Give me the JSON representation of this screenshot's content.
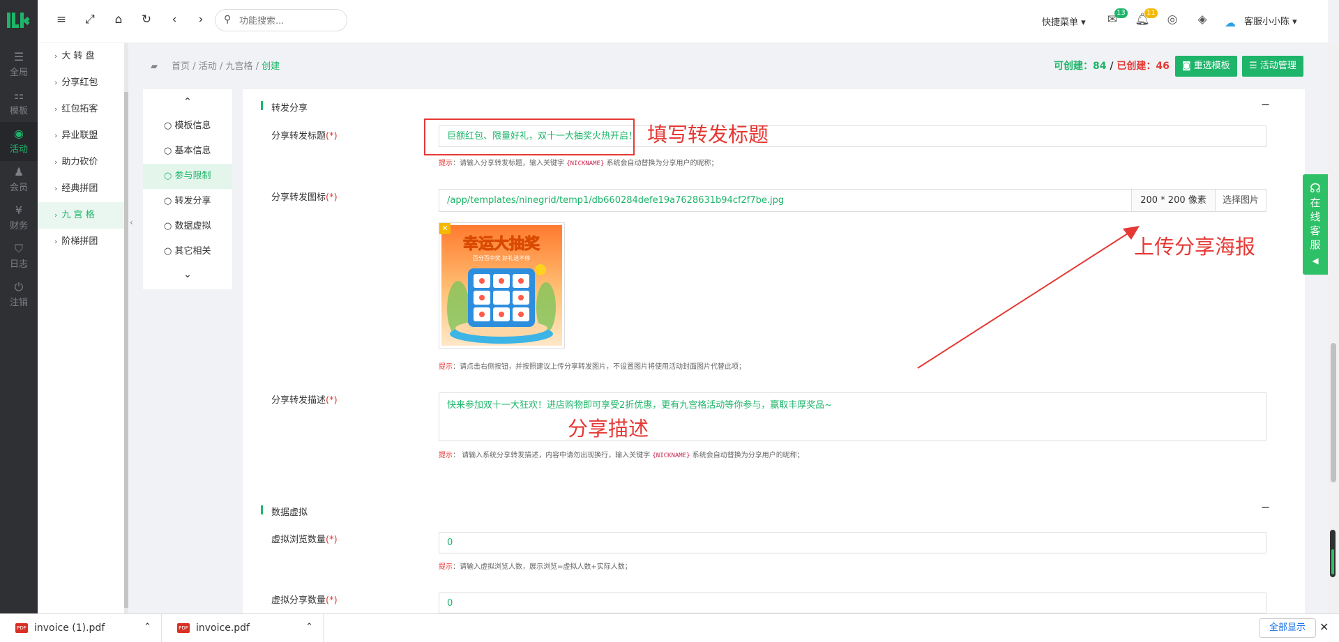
{
  "brand": {
    "color": "#1eb56a",
    "alert_red": "#e53935",
    "dark_sidebar": "#2f3033"
  },
  "iconbar": {
    "items": [
      {
        "label": "全局",
        "icon": "sliders-icon"
      },
      {
        "label": "模板",
        "icon": "sitemap-icon"
      },
      {
        "label": "活动",
        "icon": "target-icon",
        "active": true
      },
      {
        "label": "会员",
        "icon": "users-icon"
      },
      {
        "label": "财务",
        "icon": "money-icon"
      },
      {
        "label": "日志",
        "icon": "shield-icon"
      },
      {
        "label": "注销",
        "icon": "power-icon"
      }
    ]
  },
  "subnav": {
    "items": [
      {
        "label": "大 转 盘"
      },
      {
        "label": "分享红包"
      },
      {
        "label": "红包拓客"
      },
      {
        "label": "异业联盟"
      },
      {
        "label": "助力砍价"
      },
      {
        "label": "经典拼团"
      },
      {
        "label": "九 宫 格",
        "active": true
      },
      {
        "label": "阶梯拼团"
      }
    ]
  },
  "header": {
    "search_placeholder": "功能搜索...",
    "quick_menu": "快捷菜单",
    "mail_count": "13",
    "notify_count": "11",
    "user_name": "客服小小陈"
  },
  "breadcrumb": {
    "items": [
      "首页",
      "活动",
      "九宫格"
    ],
    "current": "创建",
    "sep": "/"
  },
  "quota": {
    "can_label": "可创建：",
    "can_value": "84",
    "sep": " / ",
    "done_label": "已创建：",
    "done_value": "46"
  },
  "buttons": {
    "reselect_template": "重选模板",
    "activity_manage": "活动管理"
  },
  "steps": {
    "items": [
      {
        "label": "模板信息"
      },
      {
        "label": "基本信息"
      },
      {
        "label": "参与限制",
        "active": true
      },
      {
        "label": "转发分享"
      },
      {
        "label": "数据虚拟"
      },
      {
        "label": "其它相关"
      }
    ]
  },
  "share_section": {
    "title": "转发分享",
    "collapse": "−",
    "title_label": "分享转发标题",
    "required_mark": "(*)",
    "title_value": "巨额红包、限量好礼，双十一大抽奖火热开启！",
    "title_hint_key": "提示",
    "title_hint_pre": "：请输入分享转发标题，输入关键字",
    "title_hint_code": "{NICKNAME}",
    "title_hint_post": "系统会自动替换为分享用户的昵称；",
    "icon_label": "分享转发图标",
    "icon_path": "/app/templates/ninegrid/temp1/db660284defe19a7628631b94cf2f7be.jpg",
    "icon_size": "200 * 200 像素",
    "icon_pick": "选择图片",
    "poster_text": "幸运大抽奖",
    "poster_sub": "百分百中奖 好礼送不停",
    "icon_hint_key": "提示",
    "icon_hint": "：请点击右侧按钮，并按照建议上传分享转发图片，不设置图片将使用活动封面图片代替此项；",
    "desc_label": "分享转发描述",
    "desc_value": "快来参加双十一大狂欢！进店购物即可享受2折优惠，更有九宫格活动等你参与，赢取丰厚奖品~",
    "desc_hint_key": "提示",
    "desc_hint_pre": "： 请输入系统分享转发描述，内容中请勿出现换行，输入关键字",
    "desc_hint_code": "{NICKNAME}",
    "desc_hint_post": "系统会自动替换为分享用户的昵称；"
  },
  "virtual_section": {
    "title": "数据虚拟",
    "collapse": "−",
    "views_label": "虚拟浏览数量",
    "views_value": "0",
    "views_hint_key": "提示",
    "views_hint": "：请输入虚拟浏览人数，展示浏览=虚拟人数+实际人数；",
    "shares_label": "虚拟分享数量",
    "shares_value": "0"
  },
  "annotations": {
    "title": "填写转发标题",
    "poster": "上传分享海报",
    "desc": "分享描述"
  },
  "kefu": {
    "chars": [
      "在",
      "线",
      "客",
      "服"
    ]
  },
  "downloads": {
    "files": [
      {
        "name": "invoice (1).pdf",
        "type": "PDF"
      },
      {
        "name": "invoice.pdf",
        "type": "PDF"
      }
    ],
    "show_all": "全部显示"
  }
}
